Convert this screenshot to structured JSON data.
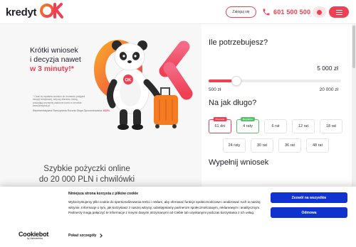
{
  "header": {
    "logo_text": "kredyt",
    "logo_ok": "OK",
    "login_label": "Zaloguj się",
    "phone": "601 500 500",
    "icons": {
      "phone": "phone-icon",
      "toggle": "contrast-toggle-icon",
      "menu": "hamburger-menu-icon"
    }
  },
  "hero": {
    "title_line1": "Krótki wniosek",
    "title_line2": "i decyzja nawet",
    "title_accent": "w 3 minuty!*",
    "fine_print": "* Czas od wysłania wniosku do momentu podjęcia decyzji kredytowej, dotyczy klientów, którzy posiadają wcześniej założone konto w serwisie www.kredytok.pl",
    "rrso_text": "Reprezentatywna Rzeczywista Roczna Stopa Oprocentowania:",
    "rrso_value": "632%",
    "subtitle_line1": "Szybkie pożyczki online",
    "subtitle_line2": "do 20 000 PLN i chwilówki"
  },
  "form": {
    "amount_title": "Ile potrzebujesz?",
    "amount_value": "5 000 zł",
    "amount_fraction": 0.21,
    "range_min": "500 zł",
    "range_max": "20 000 zł",
    "term_title": "Na jak długo?",
    "terms_row1": [
      {
        "label": "61 dni",
        "badge": "Promocja",
        "state": "selected"
      },
      {
        "label": "4 raty",
        "badge": "Bezpłatnie",
        "state": "highlight"
      },
      {
        "label": "6 rat",
        "badge": "",
        "state": ""
      },
      {
        "label": "12 rat",
        "badge": "",
        "state": ""
      },
      {
        "label": "18 rat",
        "badge": "",
        "state": ""
      }
    ],
    "terms_row2": [
      {
        "label": "24 raty",
        "badge": "",
        "state": ""
      },
      {
        "label": "30 rat",
        "badge": "",
        "state": ""
      },
      {
        "label": "36 rat",
        "badge": "",
        "state": ""
      },
      {
        "label": "48 rat",
        "badge": "",
        "state": ""
      }
    ],
    "apply_title": "Wypełnij wniosek"
  },
  "cookie": {
    "title": "Niniejsza strona korzysta z plików cookie",
    "text": "Wykorzystujemy pliki cookie do spersonalizowania treści i reklam, aby oferować funkcje społecznościowe i analizować ruch w naszej witrynie. Informacje o tym, jak korzystasz z naszej witryny, udostępniamy partnerom społecznościowym, reklamowym i analitycznym. Partnerzy mogą połączyć te informacje z innymi danymi otrzymanymi od Ciebie lub uzyskanymi podczas korzystania z ich usług.",
    "details_label": "Pokaż szczegóły",
    "allow_all_label": "Zezwól na wszystkie",
    "deny_label": "Odmowa",
    "brand_name": "Cookiebot",
    "brand_by": "by Usercentrics"
  },
  "colors": {
    "accent": "#ef3f53",
    "accent_orange": "#f47b20",
    "cookie_button": "#1032cf",
    "promo_green": "#5ac06a"
  }
}
